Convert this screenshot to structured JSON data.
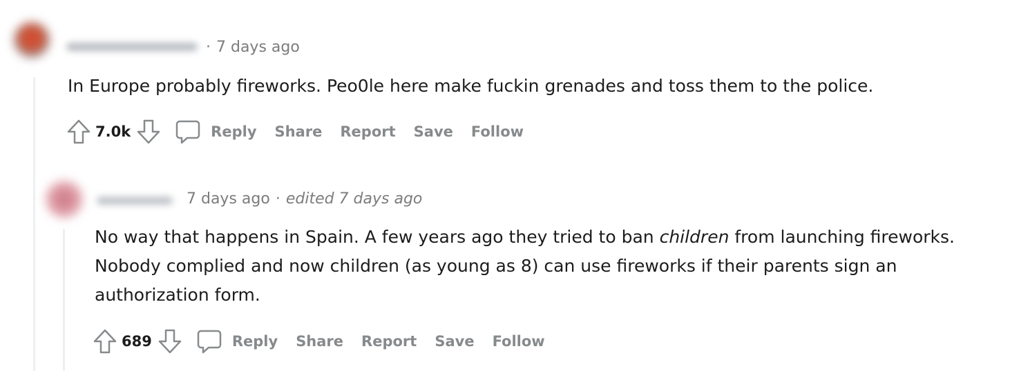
{
  "comments": [
    {
      "timestamp": "7 days ago",
      "body": "In Europe probably fireworks. Peo0le here make fuckin grenades and toss them to the police.",
      "score": "7.0k",
      "actions": {
        "reply": "Reply",
        "share": "Share",
        "report": "Report",
        "save": "Save",
        "follow": "Follow"
      }
    },
    {
      "timestamp": "7 days ago",
      "separator": "·",
      "edited": "edited 7 days ago",
      "body_before": "No way that happens in Spain. A few years ago they tried to ban ",
      "body_emphasis": "children",
      "body_after": " from launching fireworks. Nobody complied and now children (as young as 8) can use fireworks if their parents sign an authorization form.",
      "score": "689",
      "actions": {
        "reply": "Reply",
        "share": "Share",
        "report": "Report",
        "save": "Save",
        "follow": "Follow"
      }
    }
  ],
  "icons": {
    "upvote": "upvote-arrow-icon",
    "downvote": "downvote-arrow-icon",
    "comment": "speech-bubble-icon"
  },
  "colors": {
    "text": "#1c1c1c",
    "meta": "#7c7c7c",
    "action": "#878a8c",
    "thread_line": "#edeff1"
  }
}
